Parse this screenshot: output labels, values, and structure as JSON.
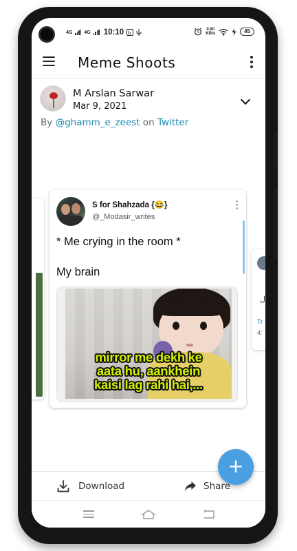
{
  "status_bar": {
    "network_1": "4G",
    "network_2": "4G",
    "time": "10:10",
    "speed_value": "0.60",
    "speed_unit": "KB/s",
    "battery": "45"
  },
  "app_bar": {
    "title": "Meme Shoots"
  },
  "post": {
    "author": "M Arslan Sarwar",
    "date": "Mar 9, 2021",
    "byline_prefix": "By",
    "byline_handle": "@ghamm_e_zeest",
    "byline_on": "on",
    "byline_platform": "Twitter"
  },
  "tweet": {
    "name": "S for Shahzada {😂}",
    "handle": "@_Modasir_writes",
    "line1": "* Me crying in the room *",
    "line2": "My brain",
    "meme_caption_1": "mirror me dekh ke",
    "meme_caption_2": "aata hu, aankhein",
    "meme_caption_3": "kaisi lag rahi hai,..."
  },
  "side_card_right": {
    "glyph": "ل",
    "link_fragment": "Tr",
    "meta_fragment": "4:"
  },
  "fab": {
    "label": "+"
  },
  "actions": {
    "download_label": "Download",
    "share_label": "Share"
  },
  "colors": {
    "accent": "#4a9fe0",
    "link": "#1a8bb3",
    "meme_text": "#d4f000"
  }
}
